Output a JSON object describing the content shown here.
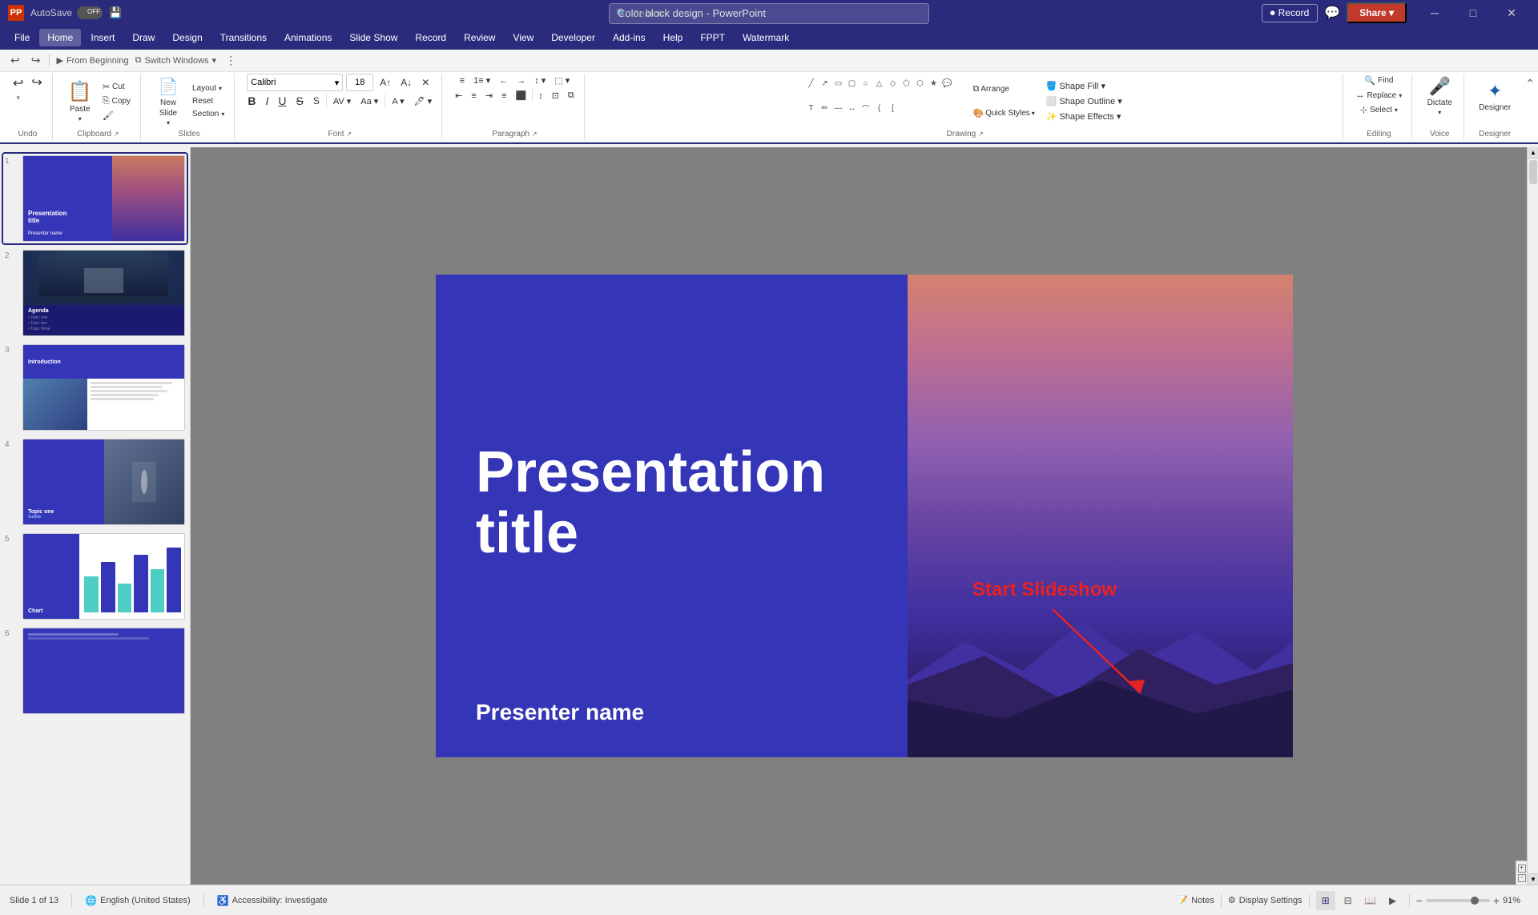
{
  "titlebar": {
    "app_name": "PP",
    "autosave_label": "AutoSave",
    "toggle_state": "OFF",
    "file_icon": "💾",
    "title": "Color block design - PowerPoint",
    "search_placeholder": "Search",
    "record_label": "Record",
    "share_label": "Share ▾",
    "minimize": "─",
    "maximize": "□",
    "close": "✕"
  },
  "menu": {
    "items": [
      "File",
      "Home",
      "Insert",
      "Draw",
      "Design",
      "Transitions",
      "Animations",
      "Slide Show",
      "Record",
      "Review",
      "View",
      "Developer",
      "Add-ins",
      "Help",
      "FPPT",
      "Watermark"
    ]
  },
  "quick_access": {
    "undo_label": "↩",
    "redo_label": "↪",
    "from_beginning_label": "From Beginning",
    "switch_windows_label": "Switch Windows"
  },
  "ribbon": {
    "groups": {
      "undo": {
        "label": "Undo",
        "buttons": [
          "↩",
          "↪"
        ]
      },
      "clipboard": {
        "label": "Clipboard",
        "paste": "Paste",
        "cut": "✂",
        "copy": "⎘",
        "format": "🖌"
      },
      "slides": {
        "label": "Slides",
        "new_slide": "New Slide",
        "layout": "Layout",
        "reset": "Reset",
        "section": "Section"
      },
      "font": {
        "label": "Font",
        "name": "Calibri",
        "size": "18",
        "bold": "B",
        "italic": "I",
        "underline": "U",
        "strikethrough": "S",
        "grow": "A↑",
        "shrink": "A↓",
        "clear": "✕"
      },
      "paragraph": {
        "label": "Paragraph",
        "bullets": "≡",
        "numbering": "1.",
        "increase": "→",
        "decrease": "←"
      },
      "drawing": {
        "label": "Drawing",
        "arrange": "Arrange",
        "quick_styles": "Quick Styles",
        "shape_fill": "Shape Fill",
        "shape_outline": "Shape Outline",
        "shape_effects": "Shape Effects"
      },
      "editing": {
        "label": "Editing",
        "find": "Find",
        "replace": "Replace",
        "select": "Select"
      },
      "voice": {
        "label": "Voice",
        "dictate": "Dictate"
      },
      "designer": {
        "label": "Designer",
        "designer": "Designer"
      }
    }
  },
  "slides": {
    "count": 13,
    "current": 1,
    "items": [
      {
        "num": "1",
        "type": "title"
      },
      {
        "num": "2",
        "type": "agenda"
      },
      {
        "num": "3",
        "type": "introduction"
      },
      {
        "num": "4",
        "type": "topic_one"
      },
      {
        "num": "5",
        "type": "chart"
      },
      {
        "num": "6",
        "type": "section"
      }
    ]
  },
  "main_slide": {
    "title_line1": "Presentation",
    "title_line2": "title",
    "presenter": "Presenter name",
    "annotation": "Start Slideshow"
  },
  "status_bar": {
    "slide_info": "Slide 1 of 13",
    "language": "English (United States)",
    "accessibility": "Accessibility: Investigate",
    "notes": "Notes",
    "display_settings": "Display Settings",
    "zoom": "91%",
    "zoom_level": "91"
  },
  "slide_labels": {
    "slide2": "Agenda",
    "slide3": "Introduction",
    "slide4_title": "Topic one",
    "slide4_sub": "Subtitle",
    "slide5": "Chart"
  }
}
